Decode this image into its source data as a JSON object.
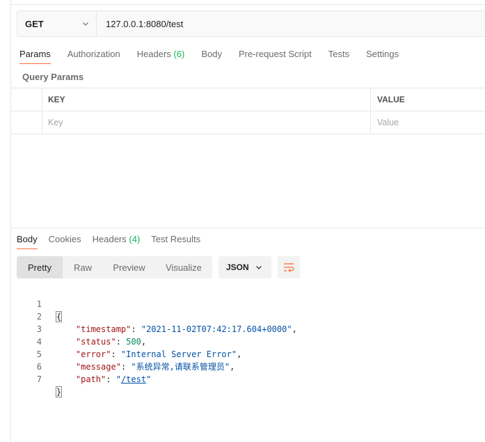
{
  "request": {
    "method": "GET",
    "url": "127.0.0.1:8080/test"
  },
  "request_tabs": [
    {
      "label": "Params",
      "active": true
    },
    {
      "label": "Authorization"
    },
    {
      "label": "Headers",
      "count": "(6)"
    },
    {
      "label": "Body"
    },
    {
      "label": "Pre-request Script"
    },
    {
      "label": "Tests"
    },
    {
      "label": "Settings"
    }
  ],
  "query_params": {
    "title": "Query Params",
    "headers": {
      "key": "KEY",
      "value": "VALUE"
    },
    "placeholders": {
      "key": "Key",
      "value": "Value"
    }
  },
  "response_tabs": [
    {
      "label": "Body",
      "active": true
    },
    {
      "label": "Cookies"
    },
    {
      "label": "Headers",
      "count": "(4)"
    },
    {
      "label": "Test Results"
    }
  ],
  "view_modes": [
    "Pretty",
    "Raw",
    "Preview",
    "Visualize"
  ],
  "format": "JSON",
  "code_lines": {
    "l1": {
      "n": "1",
      "open": "{"
    },
    "l2": {
      "n": "2",
      "key": "\"timestamp\"",
      "val": "\"2021-11-02T07:42:17.604+0000\""
    },
    "l3": {
      "n": "3",
      "key": "\"status\"",
      "val": "500"
    },
    "l4": {
      "n": "4",
      "key": "\"error\"",
      "val": "\"Internal Server Error\""
    },
    "l5": {
      "n": "5",
      "key": "\"message\"",
      "val": "\"系统异常,请联系管理员\""
    },
    "l6": {
      "n": "6",
      "key": "\"path\"",
      "val_q": "\"",
      "val_link": "/test",
      "val_q2": "\""
    },
    "l7": {
      "n": "7",
      "close": "}"
    }
  },
  "colors": {
    "accent": "#ff6c37",
    "count_green": "#0cbb52",
    "json_key": "#a31515",
    "json_string": "#0451a5",
    "json_number": "#098658"
  }
}
